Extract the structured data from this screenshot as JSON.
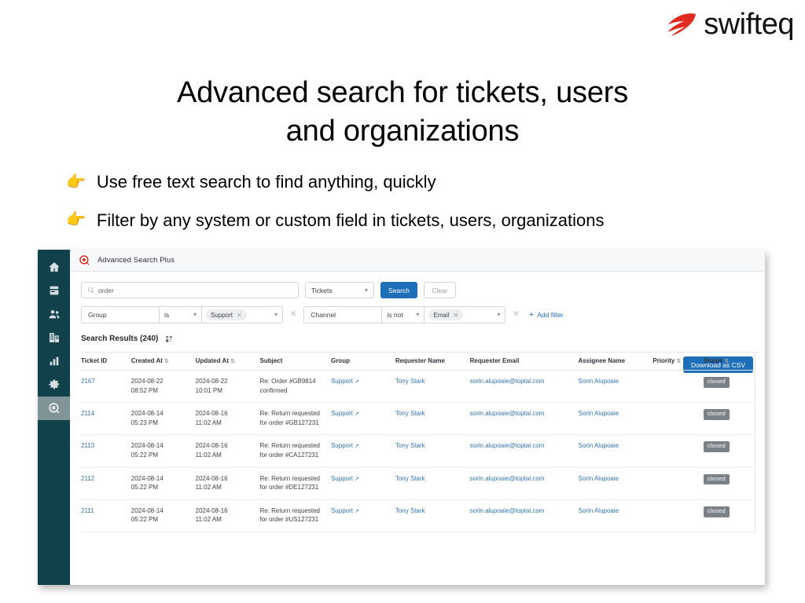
{
  "brand": {
    "name": "swifteq",
    "logo_icon": "comet-icon",
    "logo_color": "#e02b20"
  },
  "slide": {
    "headline_line1": "Advanced search for tickets, users",
    "headline_line2": "and organizations",
    "bullets": [
      {
        "icon": "pointing-right-hand",
        "text": "Use free text search to find anything, quickly"
      },
      {
        "icon": "pointing-right-hand",
        "text": "Filter by any system or custom field in tickets, users, organizations"
      }
    ]
  },
  "app": {
    "title": "Advanced Search Plus",
    "sidebar": [
      {
        "name": "home",
        "icon": "home-icon",
        "active": false
      },
      {
        "name": "articles",
        "icon": "article-icon",
        "active": false
      },
      {
        "name": "users",
        "icon": "users-icon",
        "active": false
      },
      {
        "name": "organizations",
        "icon": "building-icon",
        "active": false
      },
      {
        "name": "reports",
        "icon": "bar-chart-icon",
        "active": false
      },
      {
        "name": "settings",
        "icon": "gear-icon",
        "active": false
      },
      {
        "name": "advanced-search",
        "icon": "search-target-icon",
        "active": true
      }
    ],
    "search": {
      "value": "order",
      "placeholder": "Search",
      "icon": "search-icon",
      "entity_select": "Tickets",
      "search_button": "Search",
      "clear_button": "Clear"
    },
    "filters": [
      {
        "field": "Group",
        "operator": "is",
        "chip": "Support"
      },
      {
        "field": "Channel",
        "operator": "is not",
        "chip": "Email"
      }
    ],
    "add_filter_label": "Add filter",
    "results": {
      "label": "Search Results (240)",
      "columns_icon": "columns-icon",
      "download_button": "Download as CSV",
      "columns": [
        {
          "label": "Ticket ID",
          "sortable": false
        },
        {
          "label": "Created At",
          "sortable": true
        },
        {
          "label": "Updated At",
          "sortable": true
        },
        {
          "label": "Subject",
          "sortable": false
        },
        {
          "label": "Group",
          "sortable": false
        },
        {
          "label": "Requester Name",
          "sortable": false
        },
        {
          "label": "Requester Email",
          "sortable": false
        },
        {
          "label": "Assignee Name",
          "sortable": false
        },
        {
          "label": "Priority",
          "sortable": true
        },
        {
          "label": "Status",
          "sortable": true
        }
      ],
      "rows": [
        {
          "ticket_id": "2167",
          "created_at": "2024-08-22\n08:52 PM",
          "updated_at": "2024-08-22\n10:01 PM",
          "subject": "Re: Order #GB9814 confirmed",
          "group": "Support",
          "requester_name": "Tony Stark",
          "requester_email": "sorin.alupoaie@toptal.com",
          "assignee_name": "Sorin Alupoaie",
          "priority": "",
          "status": "closed"
        },
        {
          "ticket_id": "2114",
          "created_at": "2024-08-14\n05:23 PM",
          "updated_at": "2024-08-16\n11:02 AM",
          "subject": "Re: Return requested for order #GB127231",
          "group": "Support",
          "requester_name": "Tony Stark",
          "requester_email": "sorin.alupoaie@toptal.com",
          "assignee_name": "Sorin Alupoaie",
          "priority": "",
          "status": "closed"
        },
        {
          "ticket_id": "2113",
          "created_at": "2024-08-14\n05:22 PM",
          "updated_at": "2024-08-16\n11:02 AM",
          "subject": "Re: Return requested for order #CA127231",
          "group": "Support",
          "requester_name": "Tony Stark",
          "requester_email": "sorin.alupoaie@toptal.com",
          "assignee_name": "Sorin Alupoaie",
          "priority": "",
          "status": "closed"
        },
        {
          "ticket_id": "2112",
          "created_at": "2024-08-14\n05:22 PM",
          "updated_at": "2024-08-16\n11:02 AM",
          "subject": "Re: Return requested for order #DE127231",
          "group": "Support",
          "requester_name": "Tony Stark",
          "requester_email": "sorin.alupoaie@toptal.com",
          "assignee_name": "Sorin Alupoaie",
          "priority": "",
          "status": "closed"
        },
        {
          "ticket_id": "2111",
          "created_at": "2024-08-14\n05:22 PM",
          "updated_at": "2024-08-16\n11:02 AM",
          "subject": "Re: Return requested for order #US127231",
          "group": "Support",
          "requester_name": "Tony Stark",
          "requester_email": "sorin.alupoaie@toptal.com",
          "assignee_name": "Sorin Alupoaie",
          "priority": "",
          "status": "closed"
        }
      ]
    }
  },
  "colors": {
    "accent_blue": "#1f6fb8",
    "sidebar": "#11414a",
    "badge_grey": "#7b8187",
    "brand_red": "#e02b20"
  }
}
